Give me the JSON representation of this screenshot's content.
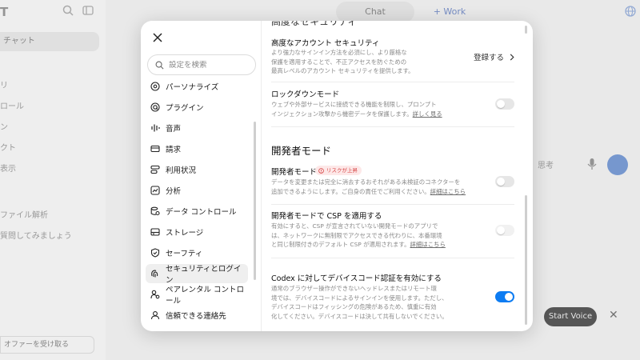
{
  "background": {
    "app_title_fragment": "T",
    "new_chat_label": "チャット",
    "sidebar_items": [
      "リ",
      "ロール",
      "ン",
      "クト",
      "表示"
    ],
    "sidebar_lower_items": [
      "ファイル解析",
      "質問してみましょう"
    ],
    "offer_label": "オファーを受け取る",
    "tab_chat": "Chat",
    "tab_work": "+ Work",
    "think_label": "思考",
    "start_voice_label": "Start Voice"
  },
  "modal": {
    "search_placeholder": "設定を検索",
    "nav_items": [
      {
        "label": "パーソナライズ",
        "icon": "personalize-icon",
        "active": false
      },
      {
        "label": "プラグイン",
        "icon": "plugin-icon",
        "active": false
      },
      {
        "label": "音声",
        "icon": "voice-icon",
        "active": false
      },
      {
        "label": "請求",
        "icon": "billing-icon",
        "active": false
      },
      {
        "label": "利用状況",
        "icon": "usage-icon",
        "active": false
      },
      {
        "label": "分析",
        "icon": "analytics-icon",
        "active": false
      },
      {
        "label": "データ コントロール",
        "icon": "data-control-icon",
        "active": false
      },
      {
        "label": "ストレージ",
        "icon": "storage-icon",
        "active": false
      },
      {
        "label": "セーフティ",
        "icon": "shield-icon",
        "active": false
      },
      {
        "label": "セキュリティとログイン",
        "icon": "security-login-icon",
        "active": true
      },
      {
        "label": "ペアレンタル コントロール",
        "icon": "parental-control-icon",
        "active": false
      },
      {
        "label": "信頼できる連絡先",
        "icon": "trusted-contacts-icon",
        "active": false
      }
    ],
    "partial_heading": "高度なセキュリティ",
    "advanced_security": {
      "title": "高度なアカウント セキュリティ",
      "desc_lines": [
        "より強力なサインイン方法を必須にし、より厳格な",
        "保護を適用することで、不正アクセスを防ぐための",
        "最高レベルのアカウント セキュリティを提供します。"
      ],
      "action_label": "登録する"
    },
    "lockdown": {
      "title": "ロックダウンモード",
      "desc_lines": [
        "ウェブや外部サービスに接続できる機能を制限し、プロンプト",
        "インジェクション攻撃から機密データを保護します。"
      ],
      "link": "詳しく見る",
      "enabled": false
    },
    "developer_section_title": "開発者モード",
    "developer_mode": {
      "title": "開発者モード",
      "badge": "リスクが上昇",
      "desc_lines": [
        "データを変更または完全に消去するおそれがある未検証のコネクターを",
        "追加できるようにします。ご自身の責任でご利用ください。"
      ],
      "link": "詳細はこちら",
      "enabled": false
    },
    "csp": {
      "title": "開発者モードで CSP を適用する",
      "desc_lines": [
        "有効にすると、CSP が宣言されていない開発モードのアプリで",
        "は、ネットワークに無制限でアクセスできる代わりに、本番環境",
        "と同じ制限付きのデフォルト CSP が適用されます。"
      ],
      "link": "詳細はこちら",
      "enabled": false,
      "disabled": true
    },
    "codex": {
      "title": "Codex に対してデバイスコード認証を有効にする",
      "desc_lines": [
        "通常のブラウザー操作ができないヘッドレスまたはリモート環",
        "境では、デバイスコードによるサインインを使用します。ただし、",
        "デバイスコードはフィッシングの危険があるため、慎重に有効",
        "化してください。デバイスコードは決して共有しないでください。"
      ],
      "enabled": true
    }
  },
  "colors": {
    "accent": "#0d7cf2",
    "risk_text": "#d64040",
    "risk_bg": "#fde8e8"
  }
}
